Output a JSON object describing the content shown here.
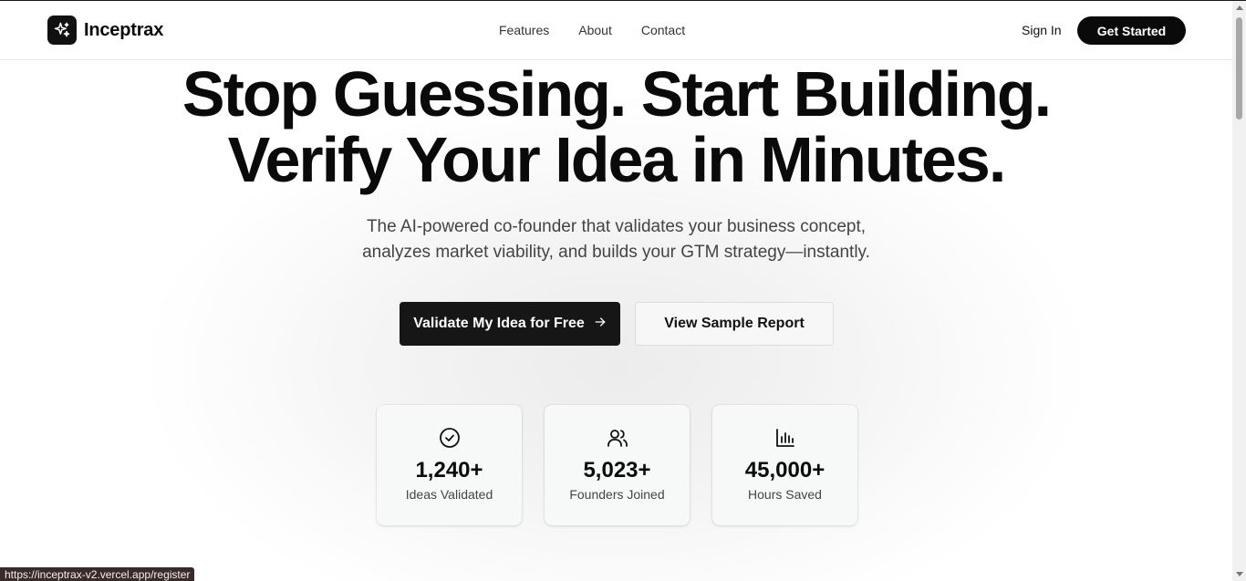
{
  "header": {
    "brand": "Inceptrax",
    "nav": [
      "Features",
      "About",
      "Contact"
    ],
    "sign_in": "Sign In",
    "get_started": "Get Started"
  },
  "hero": {
    "title_line1": "Stop Guessing. Start Building.",
    "title_line2": "Verify Your Idea in Minutes.",
    "subtitle_line1": "The AI-powered co-founder that validates your business concept,",
    "subtitle_line2": "analyzes market viability, and builds your GTM strategy—instantly.",
    "primary_cta": "Validate My Idea for Free",
    "secondary_cta": "View Sample Report"
  },
  "stats": [
    {
      "icon": "check-circle-icon",
      "value": "1,240+",
      "label": "Ideas Validated"
    },
    {
      "icon": "users-icon",
      "value": "5,023+",
      "label": "Founders Joined"
    },
    {
      "icon": "bar-chart-icon",
      "value": "45,000+",
      "label": "Hours Saved"
    }
  ],
  "status_bar": {
    "url": "https://inceptrax-v2.vercel.app/register"
  },
  "colors": {
    "primary": "#0a0a0a",
    "background": "#ffffff",
    "card": "#f7f8f8"
  }
}
